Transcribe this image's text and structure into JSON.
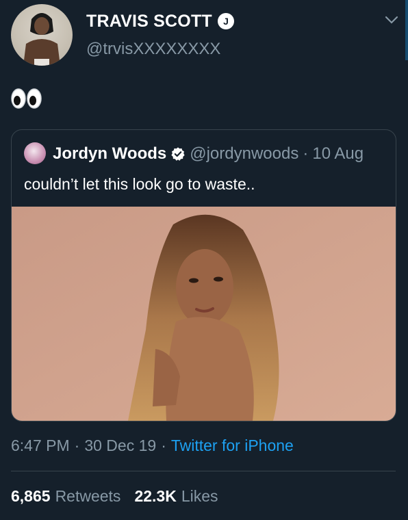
{
  "tweet": {
    "author": {
      "display_name": "TRAVIS SCOTT",
      "handle": "@trvisXXXXXXXX",
      "badge_icon": "jack-badge-icon",
      "badge_letter": "J"
    },
    "text_emoji": "👀",
    "timestamp": "6:47 PM",
    "date": "30 Dec 19",
    "source": "Twitter for iPhone",
    "separator": "·",
    "stats": {
      "retweets_count": "6,865",
      "retweets_label": "Retweets",
      "likes_count": "22.3K",
      "likes_label": "Likes"
    }
  },
  "quoted_tweet": {
    "display_name": "Jordyn Woods",
    "verified_icon": "verified-badge-icon",
    "handle": "@jordynwoods",
    "date": "10 Aug",
    "text": "couldn’t let this look go to waste.."
  },
  "colors": {
    "background": "#15202b",
    "text_primary": "#ffffff",
    "text_secondary": "#8899a6",
    "link": "#1da1f2",
    "border": "#38444d"
  }
}
